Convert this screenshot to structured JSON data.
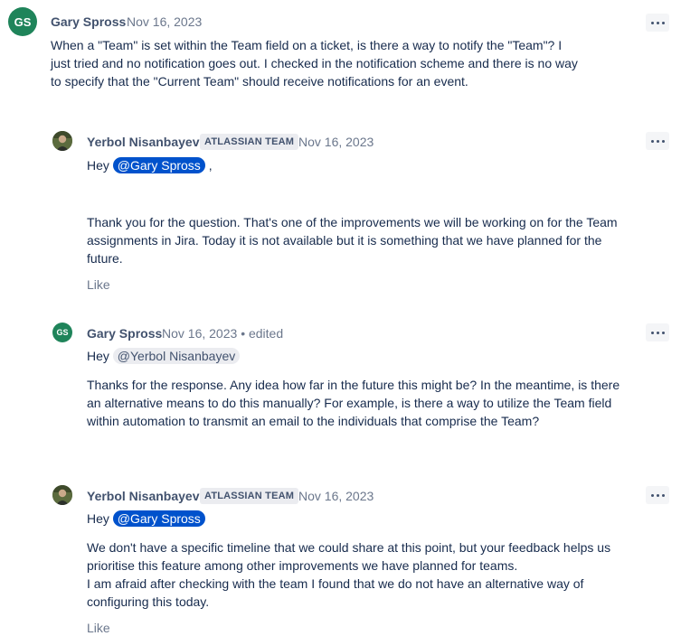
{
  "comments": [
    {
      "avatar_initials": "GS",
      "author": "Gary Spross",
      "date": "Nov 16, 2023",
      "text": "When a \"Team\" is set within the Team field on a ticket, is there a way to notify the \"Team\"? I just tried and no notification goes out. I checked in the notification scheme and there is no way to specify that the \"Current Team\" should receive notifications for an event."
    },
    {
      "author": "Yerbol Nisanbayev",
      "badge": "ATLASSIAN TEAM",
      "date": "Nov 16, 2023",
      "greeting": "Hey",
      "mention": "@Gary Spross",
      "after_mention": ",",
      "text": "Thank you for the question. That's one of the improvements we will be  working on for the Team assignments in Jira. Today it is not available but it is something that we have planned for the future.",
      "like": "Like"
    },
    {
      "avatar_initials": "GS",
      "author": "Gary Spross",
      "date": "Nov 16, 2023",
      "edited": "• edited",
      "greeting": "Hey",
      "mention": "@Yerbol Nisanbayev",
      "text": "Thanks for the response. Any idea how far in the future this might be? In the meantime, is there an alternative means to do this manually? For example, is there a way to utilize the Team field within automation to transmit an email to the individuals that comprise the Team?"
    },
    {
      "author": "Yerbol Nisanbayev",
      "badge": "ATLASSIAN TEAM",
      "date": "Nov 16, 2023",
      "greeting": "Hey",
      "mention": "@Gary Spross",
      "text1": "We don't have a specific timeline that we could share at this point, but your feedback helps us prioritise this feature among other improvements we have planned for teams.",
      "text2": "I am afraid after checking with the team I found that we do not have an alternative way of configuring this today.",
      "like": "Like"
    }
  ],
  "colors": {
    "avatar_gs": "#1f845a",
    "mention_blue": "#0052cc",
    "mention_grey": "#ebecf0"
  },
  "icons": {
    "more": "more-horizontal-icon"
  }
}
